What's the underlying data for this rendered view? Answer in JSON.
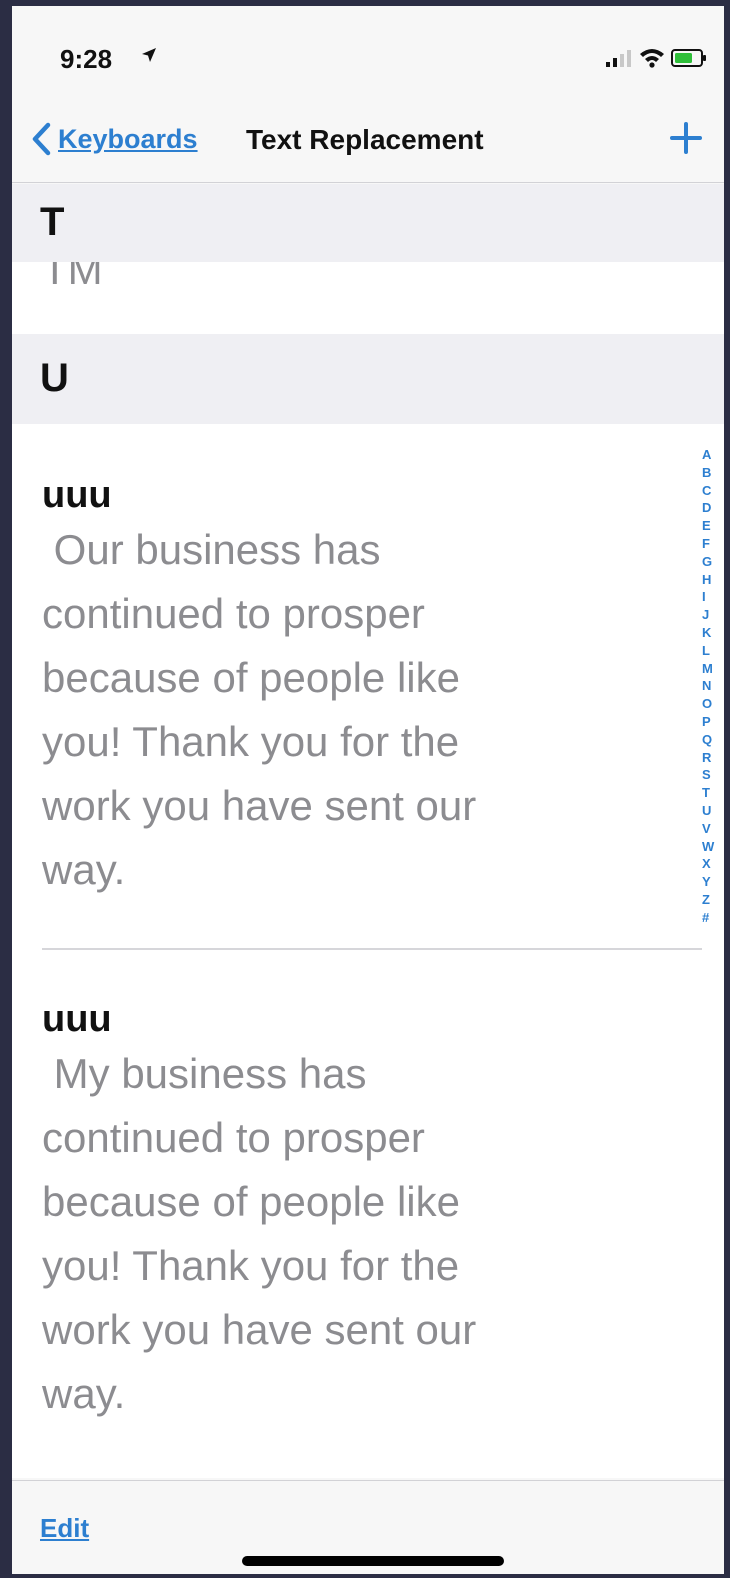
{
  "status_bar": {
    "time": "9:28"
  },
  "nav": {
    "back_label": "Keyboards",
    "title": "Text Replacement"
  },
  "sections": [
    {
      "letter": "T",
      "partial_entry": "TM"
    },
    {
      "letter": "U"
    }
  ],
  "entries": [
    {
      "shortcut": "uuu",
      "phrase": " Our business has\ncontinued to prosper\nbecause of people like\nyou! Thank you for the\nwork you have sent our\nway."
    },
    {
      "shortcut": "uuu",
      "phrase": " My business has\ncontinued to prosper\nbecause of people like\nyou! Thank you for the\nwork you have sent our\nway."
    }
  ],
  "index_letters": [
    "A",
    "B",
    "C",
    "D",
    "E",
    "F",
    "G",
    "H",
    "I",
    "J",
    "K",
    "L",
    "M",
    "N",
    "O",
    "P",
    "Q",
    "R",
    "S",
    "T",
    "U",
    "V",
    "W",
    "X",
    "Y",
    "Z",
    "#"
  ],
  "toolbar": {
    "edit_label": "Edit"
  },
  "colors": {
    "accent": "#2d7fd0",
    "secondary_text": "#8c8c90",
    "section_bg": "#efeff3"
  }
}
